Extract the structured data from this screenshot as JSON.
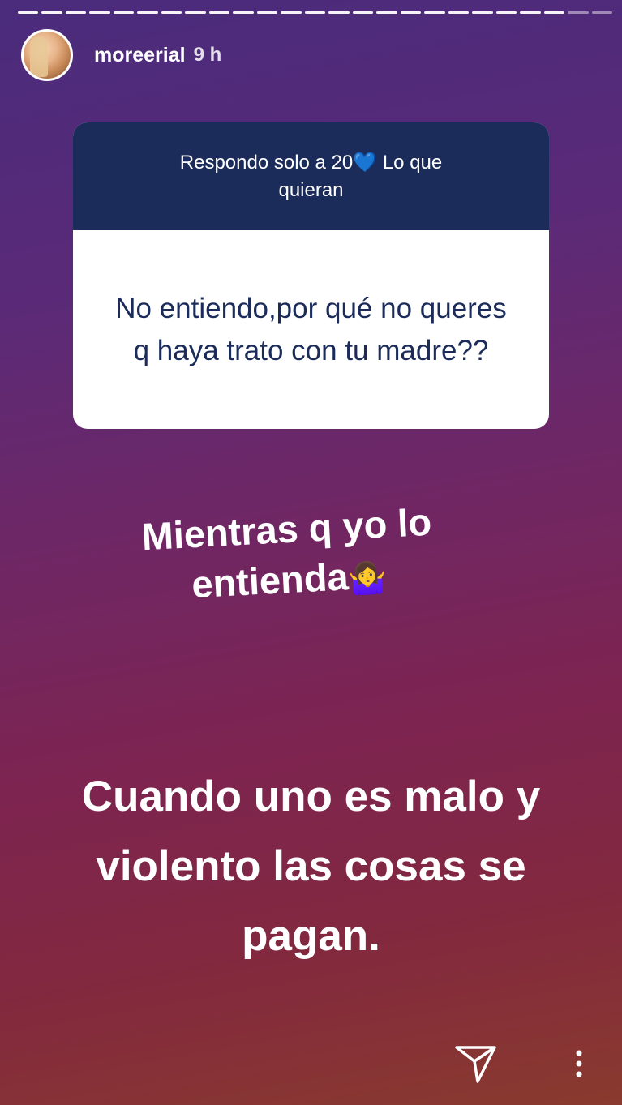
{
  "story": {
    "username": "moreerial",
    "time": "9 h",
    "progress_segments": 25,
    "progress_completed": 23
  },
  "question_box": {
    "prompt_part1": "Respondo solo a 20",
    "prompt_emoji": "💙",
    "prompt_part2": " Lo que quieran",
    "question": "No entiendo,por qué no queres q haya trato con tu madre??"
  },
  "text_sticker_1": {
    "text": "Mientras q yo lo entienda",
    "emoji": "🤷‍♀️"
  },
  "text_sticker_2": {
    "text": "Cuando uno es malo y violento las cosas se pagan."
  },
  "icons": {
    "send": "send-icon",
    "more": "more-options-icon"
  }
}
